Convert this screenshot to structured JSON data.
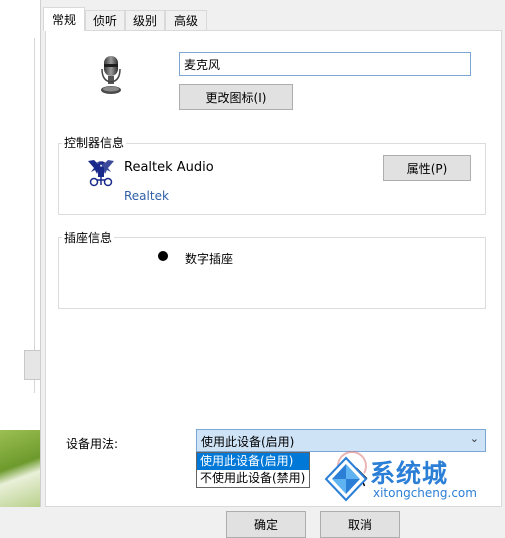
{
  "tabs": [
    {
      "label": "常规",
      "active": true
    },
    {
      "label": "侦听",
      "active": false
    },
    {
      "label": "级别",
      "active": false
    },
    {
      "label": "高级",
      "active": false
    }
  ],
  "device": {
    "icon": "microphone-icon",
    "name_value": "麦克风",
    "change_icon_label": "更改图标(I)"
  },
  "controller": {
    "section_title": "控制器信息",
    "icon": "realtek-icon",
    "name": "Realtek Audio",
    "vendor": "Realtek",
    "properties_label": "属性(P)"
  },
  "socket": {
    "section_title": "插座信息",
    "text": "数字插座"
  },
  "usage": {
    "label": "设备用法:",
    "selected": "使用此设备(启用)",
    "options": [
      "使用此设备(启用)",
      "不使用此设备(禁用)"
    ]
  },
  "footer": {
    "ok_label": "确定",
    "cancel_label": "取消"
  },
  "watermark": {
    "text": "系统城",
    "url": "xitongcheng.com"
  },
  "colors": {
    "accent": "#0078d7",
    "link": "#3060a8",
    "watermark": "#2b7fd6"
  }
}
